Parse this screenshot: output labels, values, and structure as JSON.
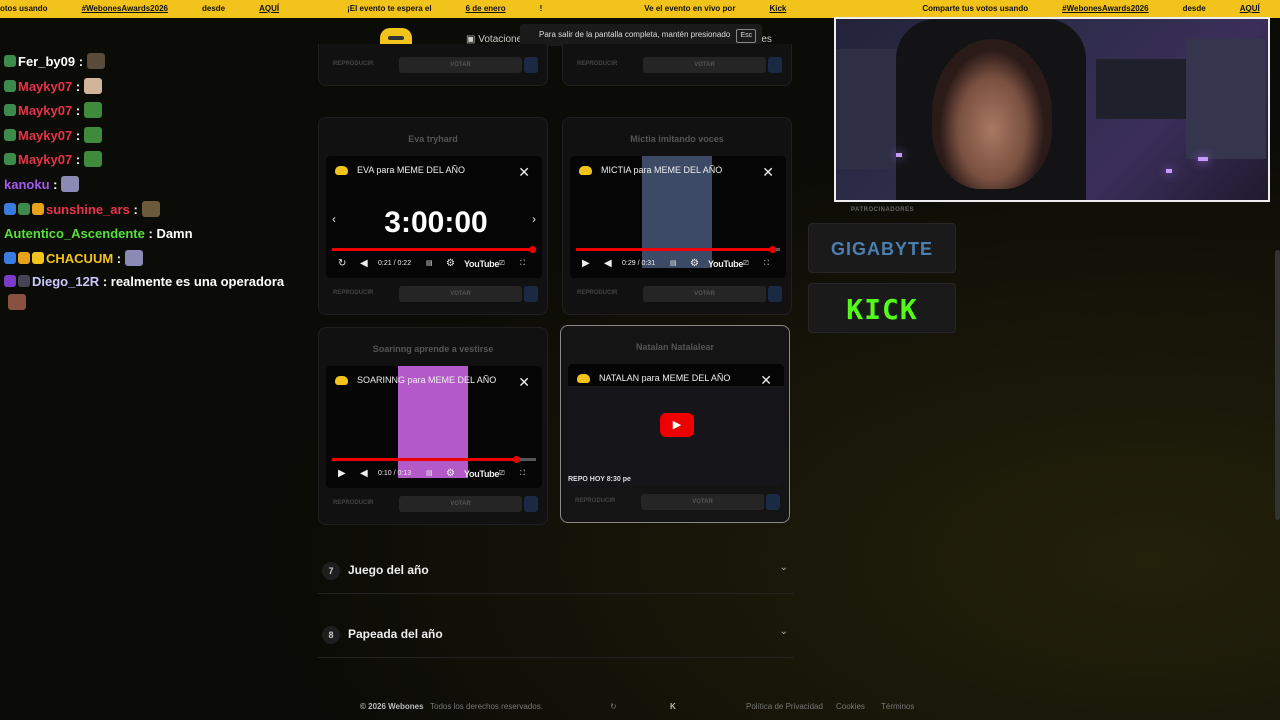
{
  "ticker": {
    "items": [
      {
        "pre": "otos usando ",
        "link": "#WebonesAwards2026",
        "post": " desde ",
        "link2": "AQUÍ"
      },
      {
        "pre": "¡El evento te espera el ",
        "link": "6 de enero",
        "post": "!",
        "link2": ""
      },
      {
        "pre": "Ve el evento en vivo por ",
        "link": "Kick",
        "post": "",
        "link2": ""
      },
      {
        "pre": "Comparte tus votos usando ",
        "link": "#WebonesAwards2026",
        "post": " desde ",
        "link2": "AQUÍ"
      },
      {
        "pre": "¡El evento te espera el ",
        "link": "6 de enero",
        "post": "!",
        "link2": ""
      },
      {
        "pre": "Ve el evento en vivo por ",
        "link": "Kick",
        "post": "",
        "link2": ""
      },
      {
        "pre": "Comparte tus votos usando ",
        "link": "#WebonesAwards2026",
        "post": " desde ",
        "link2": "AQUÍ"
      },
      {
        "pre": "¡El evento ",
        "link": "",
        "post": "",
        "link2": ""
      }
    ]
  },
  "nav": {
    "votaciones": "Votacione",
    "other": "res",
    "fullscreen_toast": "Para salir de la pantalla completa, mantén presionado",
    "esc_key": "Esc"
  },
  "chat": [
    {
      "user": "Fer_by09",
      "sep": " :",
      "text": "",
      "color": "#ffffff",
      "badges": [
        "#3c8a4c"
      ],
      "emote": "#5a4a3a"
    },
    {
      "user": "Mayky07",
      "sep": " :",
      "text": "",
      "color": "#e8324a",
      "badges": [
        "#3c8a4c"
      ],
      "emote": "#d2b49a"
    },
    {
      "user": "Mayky07",
      "sep": " :",
      "text": "",
      "color": "#e8324a",
      "badges": [
        "#3c8a4c"
      ],
      "emote": "#3f8a3c"
    },
    {
      "user": "Mayky07",
      "sep": " :",
      "text": "",
      "color": "#e8324a",
      "badges": [
        "#3c8a4c"
      ],
      "emote": "#3f8a3c"
    },
    {
      "user": "Mayky07",
      "sep": " :",
      "text": "",
      "color": "#e8324a",
      "badges": [
        "#3c8a4c"
      ],
      "emote": "#3f8a3c"
    },
    {
      "user": "kanoku",
      "sep": " :",
      "text": "",
      "color": "#a45bf0",
      "badges": [],
      "emote": "#8a8ab5"
    },
    {
      "user": "sunshine_ars",
      "sep": " :",
      "text": "",
      "color": "#e8324a",
      "badges": [
        "#3a7be0",
        "#3c8a4c",
        "#e8a21a"
      ],
      "emote": "#6b5a3c"
    },
    {
      "user": "Autentico_Ascendente",
      "sep": " :",
      "text": " Damn",
      "color": "#55e03a",
      "badges": [],
      "emote": ""
    },
    {
      "user": "CHACUUM",
      "sep": " :",
      "text": "",
      "color": "#f2c31a",
      "badges": [
        "#3a7be0",
        "#e8a21a",
        "#f2c31a"
      ],
      "emote": "#8a8ab5"
    },
    {
      "user": "Diego_12R",
      "sep": " :",
      "text": " realmente es una operadora",
      "color": "#c9c9ff",
      "badges": [
        "#7a3cc8",
        "#444455"
      ],
      "emote": "#8a5040"
    }
  ],
  "cards": [
    {
      "title": "",
      "thumb": "",
      "timer": "",
      "time": "",
      "progress": 0,
      "playing": false,
      "active": false
    },
    {
      "title": "",
      "thumb": "",
      "timer": "",
      "time": "",
      "progress": 0,
      "playing": false,
      "active": false
    },
    {
      "title": "Eva tryhard",
      "vtitle": "EVA para MEME DEL AÑO",
      "timer": "3:00:00",
      "time": "0:21 / 0:22",
      "progress": 0.98,
      "playing": true,
      "active": false,
      "thumb": ""
    },
    {
      "title": "Mictia imitando voces",
      "vtitle": "MICTIA para MEME DEL AÑO",
      "timer": "",
      "time": "0:29 / 0:31",
      "progress": 0.96,
      "playing": false,
      "active": false,
      "thumb": "#3d4a66"
    },
    {
      "title": "Soarinng aprende a vestirse",
      "vtitle": "SOARINNG para MEME DEL AÑO",
      "timer": "",
      "time": "0:10 / 0:13",
      "progress": 0.9,
      "playing": false,
      "active": false,
      "thumb": "#b45ac8"
    },
    {
      "title": "Natalan Natalalear",
      "vtitle": "NATALAN para MEME DEL AÑO",
      "timer": "",
      "time": "",
      "progress": 0,
      "playing": false,
      "active": true,
      "thumb": "#1a1a1e",
      "overlay": "REPO HOY 8:30 pe"
    }
  ],
  "card_actions": {
    "reproducir": "REPRODUCIR",
    "votar": "VOTAR"
  },
  "youtube": "YouTube",
  "accordion": [
    {
      "num": "7",
      "label": "Juego del año"
    },
    {
      "num": "8",
      "label": "Papeada del año"
    }
  ],
  "footer": {
    "copyright": "© 2026 Webones",
    "rights": "Todos los derechos reservados.",
    "privacy": "Política de Privacidad",
    "cookies": "Cookies",
    "terms": "Términos"
  },
  "sponsors": {
    "title": "PATROCINADORES",
    "items": [
      "GIGABYTE",
      "KICK"
    ]
  },
  "colors": {
    "accent": "#f2c31a",
    "youtube_red": "#e00000",
    "kick_green": "#53fc18"
  }
}
